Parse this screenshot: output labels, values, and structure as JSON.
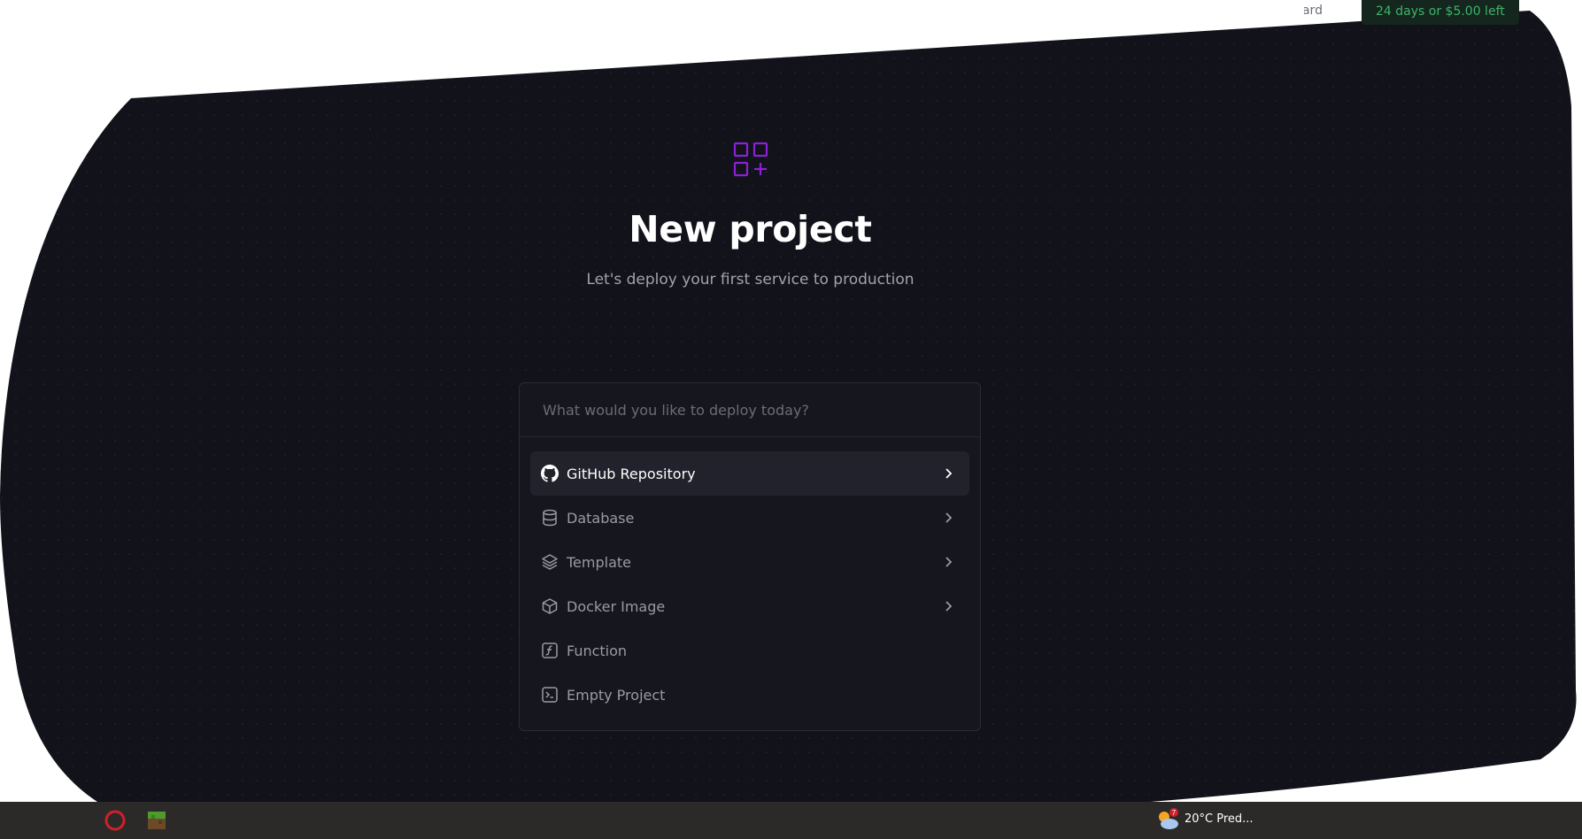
{
  "topbar": {
    "dashboard_label": "Dashboard",
    "trial_badge": "24 days or $5.00 left"
  },
  "hero": {
    "icon": "grid-plus-icon",
    "title": "New project",
    "subtitle": "Let's deploy your first service to production"
  },
  "search": {
    "placeholder": "What would you like to deploy today?",
    "value": ""
  },
  "options": [
    {
      "label": "GitHub Repository",
      "icon": "github-icon",
      "has_submenu": true
    },
    {
      "label": "Database",
      "icon": "database-icon",
      "has_submenu": true
    },
    {
      "label": "Template",
      "icon": "layers-icon",
      "has_submenu": true
    },
    {
      "label": "Docker Image",
      "icon": "cube-icon",
      "has_submenu": true
    },
    {
      "label": "Function",
      "icon": "function-icon",
      "has_submenu": false
    },
    {
      "label": "Empty Project",
      "icon": "terminal-icon",
      "has_submenu": false
    }
  ],
  "taskbar": {
    "weather_text": "20°C  Pred...",
    "weather_badge": "7"
  },
  "colors": {
    "background": "#12121a",
    "accent": "#8b20d8",
    "trial_green": "#3fb36b"
  }
}
